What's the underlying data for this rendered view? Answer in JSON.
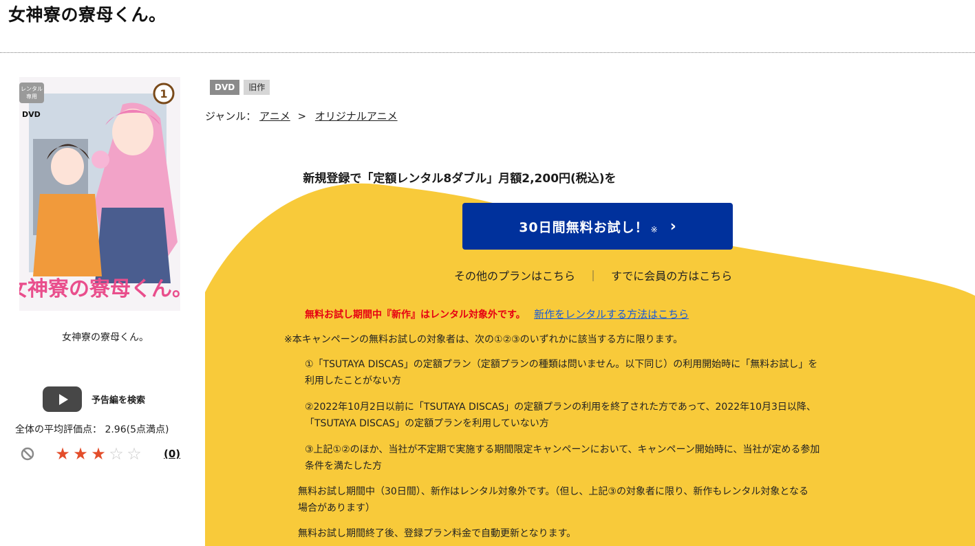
{
  "page": {
    "title": "女神寮の寮母くん。"
  },
  "cover": {
    "caption": "女神寮の寮母くん。"
  },
  "trailer": {
    "label": "予告編を検索"
  },
  "rating": {
    "text": "全体の平均評価点： 2.96(5点満点)",
    "stars_filled": 3,
    "stars_total": 5,
    "review_count": "(0)"
  },
  "tags": [
    "DVD",
    "旧作"
  ],
  "genre": {
    "label": "ジャンル：",
    "parent": "アニメ",
    "separator": ">",
    "child": "オリジナルアニメ"
  },
  "promo": {
    "headline": "新規登録で「定額レンタル8ダブル」月額2,200円(税込)を",
    "cta_label": "30日間無料お試し！",
    "cta_mark": "※",
    "other_plans": "その他のプランはこちら",
    "divider": "｜",
    "member_link": "すでに会員の方はこちら",
    "warning": "無料お試し期間中『新作』はレンタル対象外です。",
    "how_to_link": "新作をレンタルする方法はこちら",
    "eligibility_intro": "※本キャンペーンの無料お試しの対象者は、次の①②③のいずれかに該当する方に限ります。",
    "condition_1_line1": "①「TSUTAYA DISCAS」の定額プラン（定額プランの種類は問いません。以下同じ）の利用開始時に「無料お試し」を",
    "condition_1_line2": "利用したことがない方",
    "condition_2_line1": "②2022年10月2日以前に「TSUTAYA DISCAS」の定額プランの利用を終了された方であって、2022年10月3日以降、",
    "condition_2_line2": "「TSUTAYA DISCAS」の定額プランを利用していない方",
    "condition_3_line1": "③上記①②のほか、当社が不定期で実施する期間限定キャンペーンにおいて、キャンペーン開始時に、当社が定める参加",
    "condition_3_line2": "条件を満たした方",
    "note_1_line1": "無料お試し期間中（30日間）、新作はレンタル対象外です。（但し、上記③の対象者に限り、新作もレンタル対象となる",
    "note_1_line2": "場合があります）",
    "note_2": "無料お試し期間終了後、登録プラン料金で自動更新となります。"
  },
  "colors": {
    "promo_background": "#f8ca3a",
    "cta": "#00319c",
    "warning": "#e60012",
    "link": "#1a5bd6"
  }
}
